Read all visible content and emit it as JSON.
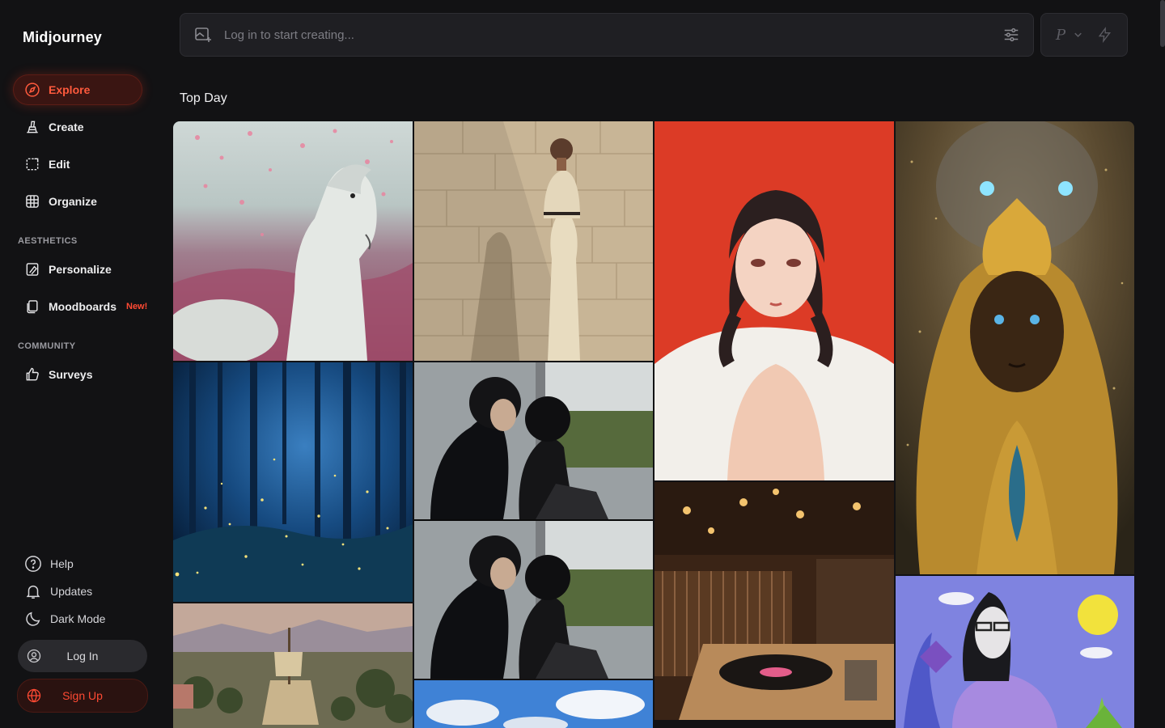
{
  "app": {
    "name": "Midjourney"
  },
  "nav": {
    "items": [
      {
        "label": "Explore",
        "icon": "compass-icon",
        "active": true
      },
      {
        "label": "Create",
        "icon": "brush-icon",
        "active": false
      },
      {
        "label": "Edit",
        "icon": "edit-frame-icon",
        "active": false
      },
      {
        "label": "Organize",
        "icon": "grid-icon",
        "active": false
      }
    ],
    "aesthetics_label": "AESTHETICS",
    "aesthetics": [
      {
        "label": "Personalize",
        "icon": "personalize-icon"
      },
      {
        "label": "Moodboards",
        "icon": "moodboard-icon",
        "badge": "New!"
      }
    ],
    "community_label": "COMMUNITY",
    "community": [
      {
        "label": "Surveys",
        "icon": "thumbs-up-icon"
      }
    ]
  },
  "footer": {
    "help": "Help",
    "updates": "Updates",
    "dark_mode": "Dark Mode",
    "login": "Log In",
    "signup": "Sign Up"
  },
  "prompt": {
    "placeholder": "Log in to start creating..."
  },
  "mode": {
    "letter": "P"
  },
  "gallery": {
    "title": "Top Day",
    "images": [
      {
        "name": "white-horse-pink-petals",
        "alt": "White horse in pink flower field"
      },
      {
        "name": "woman-stone-wall",
        "alt": "Woman in cream outfit against stone wall"
      },
      {
        "name": "anime-girl-red",
        "alt": "Anime girl on red background"
      },
      {
        "name": "golden-goddess-lion",
        "alt": "Golden goddess with lion spirit"
      },
      {
        "name": "firefly-forest",
        "alt": "Blue forest with fireflies"
      },
      {
        "name": "couple-film-still",
        "alt": "Couple film still, two frames"
      },
      {
        "name": "record-store",
        "alt": "Record store with turntable"
      },
      {
        "name": "desert-ship",
        "alt": "Ship in desert oasis"
      },
      {
        "name": "clay-character",
        "alt": "Clay figure with glasses"
      },
      {
        "name": "blue-sky",
        "alt": "Blue sky with clouds"
      }
    ]
  },
  "colors": {
    "accent": "#ff4a33",
    "background": "#121214"
  }
}
